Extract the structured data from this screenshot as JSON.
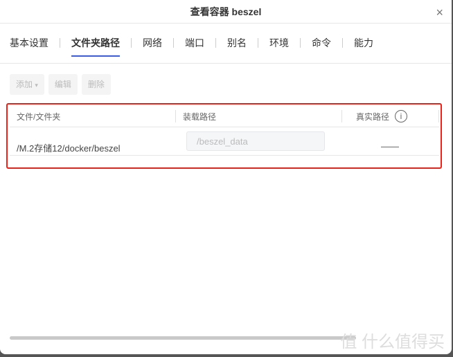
{
  "dialog": {
    "title": "查看容器 beszel",
    "close": "×"
  },
  "tabs": [
    {
      "label": "基本设置"
    },
    {
      "label": "文件夹路径",
      "active": true
    },
    {
      "label": "网络"
    },
    {
      "label": "端口"
    },
    {
      "label": "别名"
    },
    {
      "label": "环境"
    },
    {
      "label": "命令"
    },
    {
      "label": "能力"
    }
  ],
  "toolbar": {
    "add": "添加",
    "add_caret": "▾",
    "edit": "编辑",
    "delete": "删除"
  },
  "table": {
    "headers": [
      "文件/文件夹",
      "装载路径",
      "真实路径"
    ],
    "info_icon": "i",
    "rows": [
      {
        "file": "/M.2存储12/docker/beszel",
        "mount": "/beszel_data",
        "real": "——"
      }
    ]
  },
  "watermark": "值 什么值得买"
}
